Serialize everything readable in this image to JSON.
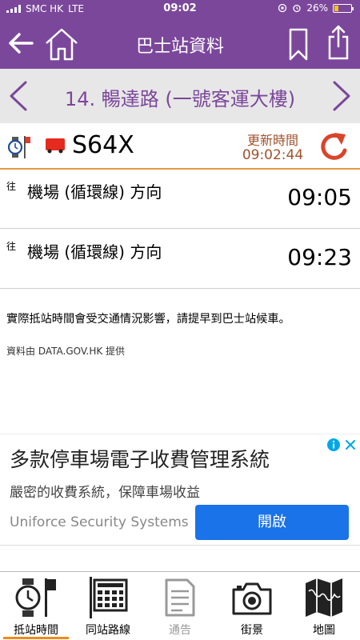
{
  "status_bar": {
    "carrier": "SMC HK",
    "network": "LTE",
    "time": "09:02",
    "battery": "26%",
    "battery_level": 0.26
  },
  "header": {
    "title": "巴士站資料"
  },
  "stop": {
    "name": "14. 暢達路 (一號客運大樓)"
  },
  "route": {
    "number": "S64X",
    "updated_label": "更新時間",
    "updated_time": "09:02:44"
  },
  "etas": [
    {
      "tag": "往",
      "destination": "機場 (循環線) 方向",
      "time": "09:05"
    },
    {
      "tag": "往",
      "destination": "機場 (循環線) 方向",
      "time": "09:23"
    }
  ],
  "note": "實際抵站時間會受交通情況影響，請提早到巴士站候車。",
  "source": "資料由 DATA.GOV.HK 提供",
  "ad": {
    "headline": "多款停車場電子收費管理系統",
    "subline": "嚴密的收費系統，保障車場收益",
    "company": "Uniforce Security Systems",
    "cta": "開啟"
  },
  "tabs": [
    {
      "label": "抵站時間",
      "active": true
    },
    {
      "label": "同站路線",
      "active": false
    },
    {
      "label": "通告",
      "active": false,
      "disabled": true
    },
    {
      "label": "街景",
      "active": false
    },
    {
      "label": "地圖",
      "active": false
    }
  ],
  "colors": {
    "header_bg": "#7b479b",
    "stopbar_bg": "#e7e7e7",
    "accent_orange": "#e39a3b",
    "refresh_red": "#d9452b",
    "ad_button": "#1a73e8"
  }
}
